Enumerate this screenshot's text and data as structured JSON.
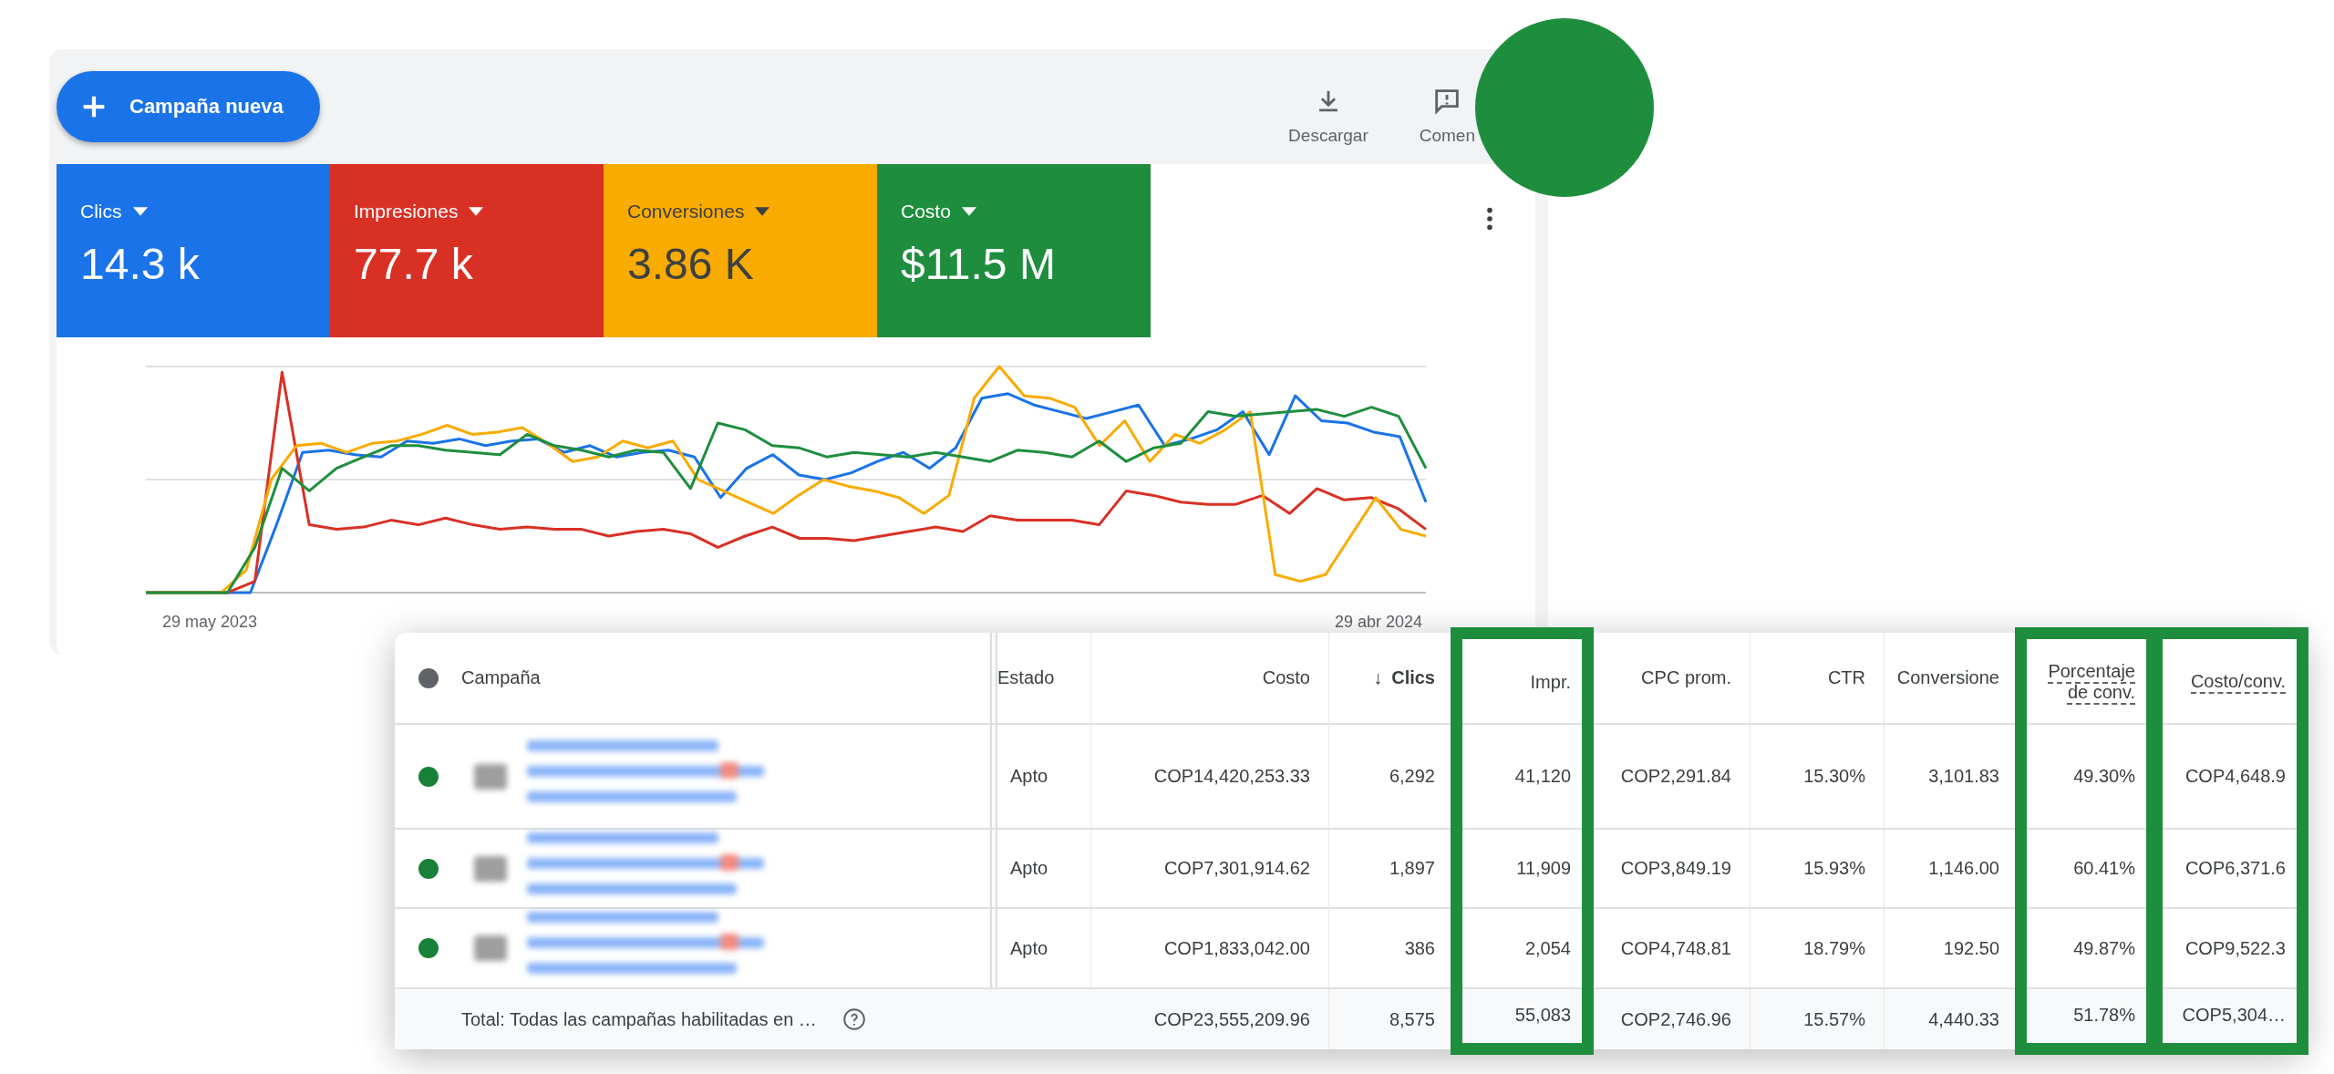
{
  "toolbar": {
    "new_campaign_button": "Campaña nueva",
    "actions": [
      {
        "label": "Descargar",
        "kind": "download"
      },
      {
        "label": "Comen",
        "kind": "feedback"
      }
    ]
  },
  "metrics": [
    {
      "label": "Clics",
      "value": "14.3 k",
      "color": "#1a73e8",
      "selected": true
    },
    {
      "label": "Impresiones",
      "value": "77.7 k",
      "color": "#d93025",
      "selected": true
    },
    {
      "label": "Conversiones",
      "value": "3.86 K",
      "color": "#f9ab00",
      "selected": true
    },
    {
      "label": "Costo",
      "value": "$11.5 M",
      "color": "#1e8e3e",
      "selected": true
    }
  ],
  "chart": {
    "x_start": "29 may 2023",
    "x_end": "29 abr 2024"
  },
  "table": {
    "columns": [
      {
        "label": "Estado",
        "highlighted": false,
        "underlined": false
      },
      {
        "label": "Costo",
        "highlighted": false,
        "underlined": false
      },
      {
        "label": "Clics",
        "highlighted": false,
        "underlined": false,
        "sort_arrow": "↓"
      },
      {
        "label": "Impr.",
        "highlighted": true,
        "underlined": false
      },
      {
        "label": "CPC prom.",
        "highlighted": false,
        "underlined": false
      },
      {
        "label": "CTR",
        "highlighted": false,
        "underlined": false
      },
      {
        "label": "Conversione",
        "highlighted": false,
        "underlined": false
      },
      {
        "label": "Porcentaje de conv.",
        "highlighted": true,
        "underlined": true
      },
      {
        "label": "Costo/conv.",
        "highlighted": true,
        "underlined": true
      }
    ],
    "campaign_header": "Campaña",
    "rows": [
      {
        "color": "#188038",
        "cells": [
          "Apto",
          "COP14,420,253.33",
          "6,292",
          "41,120",
          "COP2,291.84",
          "15.30%",
          "3,101.83",
          "49.30%",
          "COP4,648.9"
        ]
      },
      {
        "color": "#188038",
        "cells": [
          "Apto",
          "COP7,301,914.62",
          "1,897",
          "11,909",
          "COP3,849.19",
          "15.93%",
          "1,146.00",
          "60.41%",
          "COP6,371.6"
        ]
      },
      {
        "color": "#188038",
        "cells": [
          "Apto",
          "COP1,833,042.00",
          "386",
          "2,054",
          "COP4,748.81",
          "18.79%",
          "192.50",
          "49.87%",
          "COP9,522.3"
        ]
      }
    ],
    "total": {
      "label": "Total: Todas las campañas habilitadas en …",
      "cells": [
        "COP23,555,209.96",
        "8,575",
        "55,083",
        "COP2,746.96",
        "15.57%",
        "4,440.33",
        "51.78%",
        "COP5,304…"
      ]
    }
  }
}
